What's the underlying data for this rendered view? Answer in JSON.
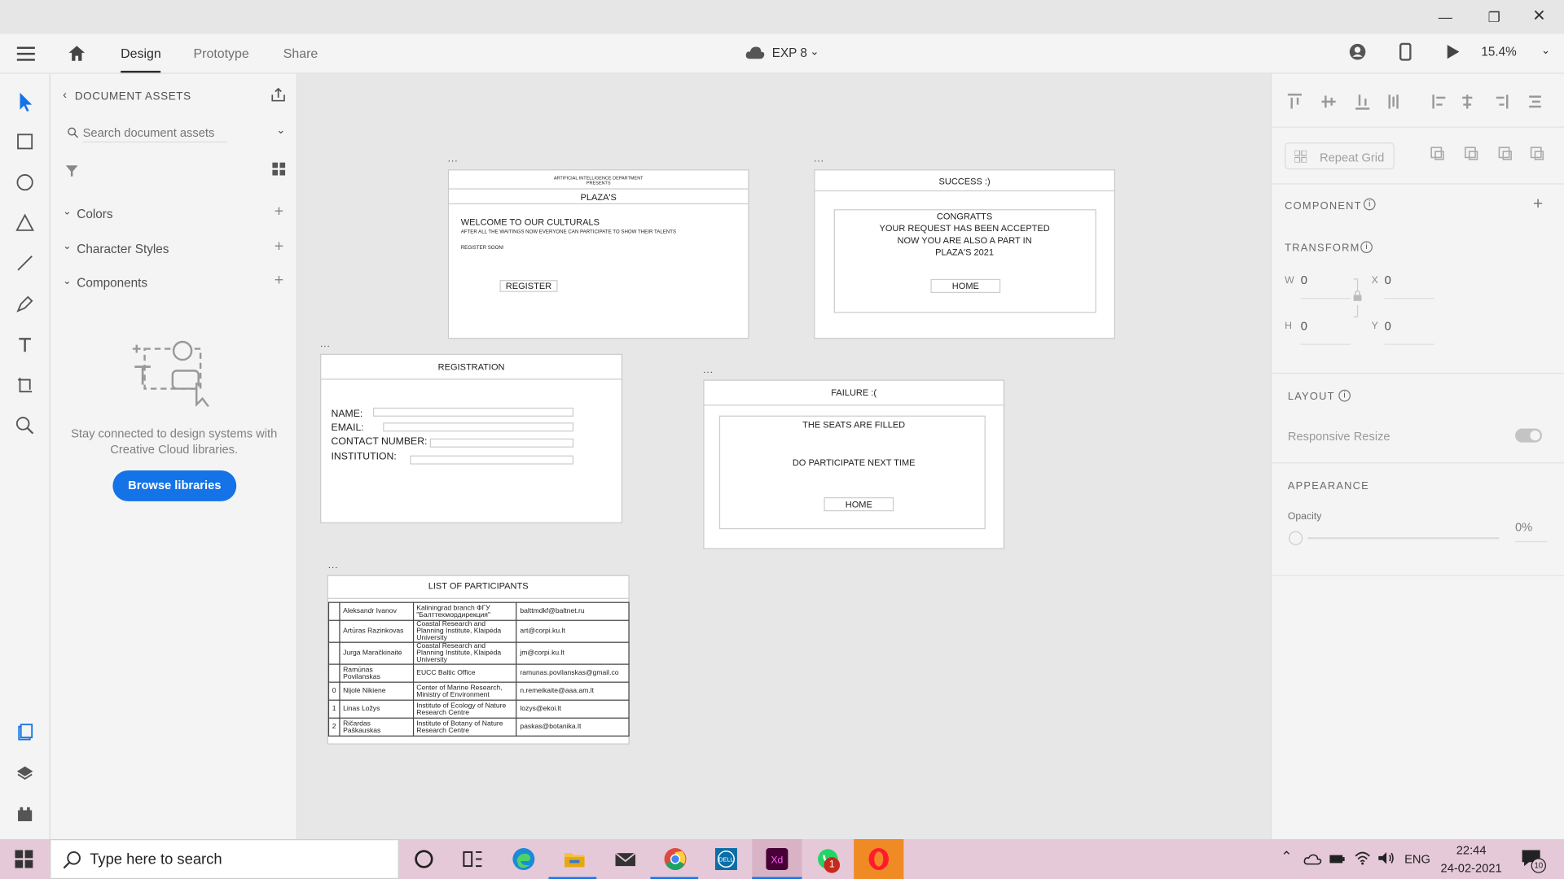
{
  "app": {
    "tabs": [
      "Design",
      "Prototype",
      "Share"
    ],
    "document": "EXP 8",
    "zoom": "15.4%"
  },
  "assets": {
    "title": "DOCUMENT ASSETS",
    "search_placeholder": "Search document assets",
    "sections": [
      "Colors",
      "Character Styles",
      "Components"
    ],
    "empty_text_1": "Stay connected to design systems with",
    "empty_text_2": "Creative Cloud libraries.",
    "browse_label": "Browse libraries"
  },
  "artboards": {
    "label": "...",
    "home": {
      "dept": "ARTIFICIAL INTELLIGENCE DEPARTMENT",
      "presents": "PRESENTS",
      "title": "PLAZA'S",
      "welcome": "WELCOME TO OUR CULTURALS",
      "sub": "AFTER ALL THE WAITINGS NOW EVERYONE CAN PARTICIPATE TO SHOW THEIR TALENTS",
      "soon": "REGISTER SOON!",
      "register": "REGISTER"
    },
    "success": {
      "title": "SUCCESS :)",
      "l1": "CONGRATTS",
      "l2": "YOUR REQUEST HAS BEEN ACCEPTED",
      "l3": "NOW YOU ARE ALSO A PART IN",
      "l4": "PLAZA'S 2021",
      "home": "HOME"
    },
    "registration": {
      "title": "REGISTRATION",
      "name": "NAME:",
      "email": "EMAIL:",
      "contact": "CONTACT NUMBER:",
      "institution": "INSTITUTION:"
    },
    "failure": {
      "title": "FAILURE :(",
      "l1": "THE SEATS ARE FILLED",
      "l2": "DO PARTICIPATE NEXT TIME",
      "home": "HOME"
    },
    "participants": {
      "title": "LIST OF PARTICIPANTS",
      "rows": [
        {
          "idx": "",
          "name": "Aleksandr Ivanov",
          "inst": "Kaliningrad branch ФГУ \"Балттехмордирекция\"",
          "email": "balttmdkf@baltnet.ru"
        },
        {
          "idx": "",
          "name": "Artūras Razinkovas",
          "inst": "Coastal Research and Planning Institute, Klaipėda University",
          "email": "art@corpi.ku.lt"
        },
        {
          "idx": "",
          "name": "Jurga Maračkinaitė",
          "inst": "Coastal Research and Planning Institute, Klaipėda University",
          "email": "jm@corpi.ku.lt"
        },
        {
          "idx": "",
          "name": "Ramūnas Povilanskas",
          "inst": "EUCC Baltic Office",
          "email": "ramunas.povilanskas@gmail.co"
        },
        {
          "idx": "0",
          "name": "Nijolė Nikiene",
          "inst": "Center of Marine Research, Ministry of Environment",
          "email": "n.remeikaite@aaa.am.lt"
        },
        {
          "idx": "1",
          "name": "Linas Ložys",
          "inst": "Institute of Ecology of Nature Research Centre",
          "email": "lozys@ekoi.lt"
        },
        {
          "idx": "2",
          "name": "Ričardas Paškauskas",
          "inst": "Institute of Botany of Nature Research Centre",
          "email": "paskas@botanika.lt"
        }
      ]
    }
  },
  "props": {
    "repeat_grid": "Repeat Grid",
    "component": "COMPONENT",
    "transform": "TRANSFORM",
    "w_label": "W",
    "w": "0",
    "x_label": "X",
    "x": "0",
    "h_label": "H",
    "h": "0",
    "y_label": "Y",
    "y": "0",
    "layout": "LAYOUT",
    "responsive": "Responsive Resize",
    "appearance": "APPEARANCE",
    "opacity_label": "Opacity",
    "opacity": "0%"
  },
  "taskbar": {
    "search_placeholder": "Type here to search",
    "lang": "ENG",
    "time": "22:44",
    "date": "24-02-2021",
    "notif_count": "10",
    "whatsapp_badge": "1"
  }
}
